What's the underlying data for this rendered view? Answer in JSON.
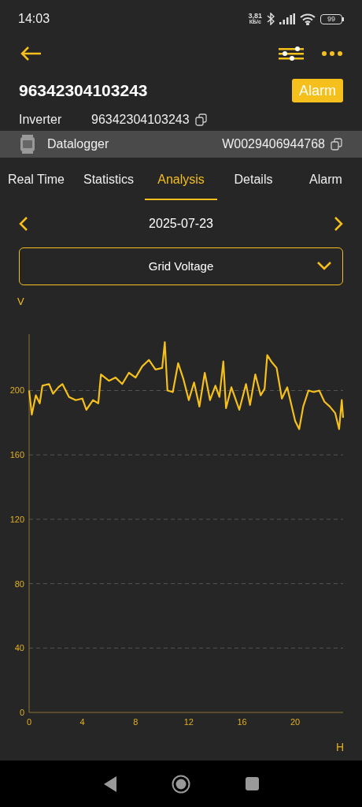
{
  "status_bar": {
    "time": "14:03",
    "net_speed": "3,81",
    "net_unit": "КБ/с",
    "battery": "99"
  },
  "header": {
    "title": "96342304103243",
    "alarm_button": "Alarm"
  },
  "inverter": {
    "label": "Inverter",
    "serial": "96342304103243"
  },
  "datalogger": {
    "label": "Datalogger",
    "serial": "W0029406944768"
  },
  "tabs": [
    {
      "label": "Real Time",
      "selected": false
    },
    {
      "label": "Statistics",
      "selected": false
    },
    {
      "label": "Analysis",
      "selected": true
    },
    {
      "label": "Details",
      "selected": false
    },
    {
      "label": "Alarm",
      "selected": false
    }
  ],
  "date": "2025-07-23",
  "metric_dropdown": {
    "value": "Grid Voltage"
  },
  "chart_data": {
    "type": "line",
    "xlabel": "H",
    "ylabel": "V",
    "x": [
      0,
      0.2,
      0.5,
      0.8,
      1.0,
      1.5,
      1.8,
      2.2,
      2.5,
      3.0,
      3.5,
      4.0,
      4.3,
      4.8,
      5.2,
      5.4,
      6.0,
      6.5,
      7.0,
      7.5,
      8.0,
      8.5,
      9.0,
      9.5,
      10.0,
      10.2,
      10.4,
      10.8,
      11.2,
      11.6,
      12.0,
      12.4,
      12.8,
      13.2,
      13.6,
      14.0,
      14.3,
      14.6,
      14.8,
      15.2,
      15.8,
      16.3,
      16.6,
      17.0,
      17.4,
      17.7,
      17.9,
      18.2,
      18.6,
      19.0,
      19.4,
      20.0,
      20.3,
      20.6,
      21.0,
      21.4,
      21.8,
      22.2,
      22.6,
      23.0,
      23.3,
      23.5,
      23.6
    ],
    "series": [
      {
        "color": "#f5bf1c",
        "values": [
          200,
          185,
          197,
          192,
          203,
          204,
          198,
          202,
          204,
          196,
          194,
          195,
          188,
          194,
          192,
          210,
          206,
          208,
          204,
          211,
          208,
          215,
          219,
          213,
          214,
          230,
          200,
          199,
          217,
          207,
          194,
          205,
          190,
          211,
          194,
          203,
          196,
          218,
          189,
          202,
          188,
          204,
          191,
          210,
          197,
          201,
          222,
          218,
          214,
          195,
          202,
          181,
          176,
          190,
          200,
          199,
          200,
          193,
          190,
          186,
          176,
          194,
          183
        ]
      }
    ],
    "grid": true,
    "xlim": [
      0,
      23.6
    ],
    "ylim": [
      0,
      235
    ],
    "xticks": [
      0,
      4,
      8,
      12,
      16,
      20
    ],
    "yticks": [
      0,
      40,
      80,
      120,
      160,
      200
    ]
  }
}
